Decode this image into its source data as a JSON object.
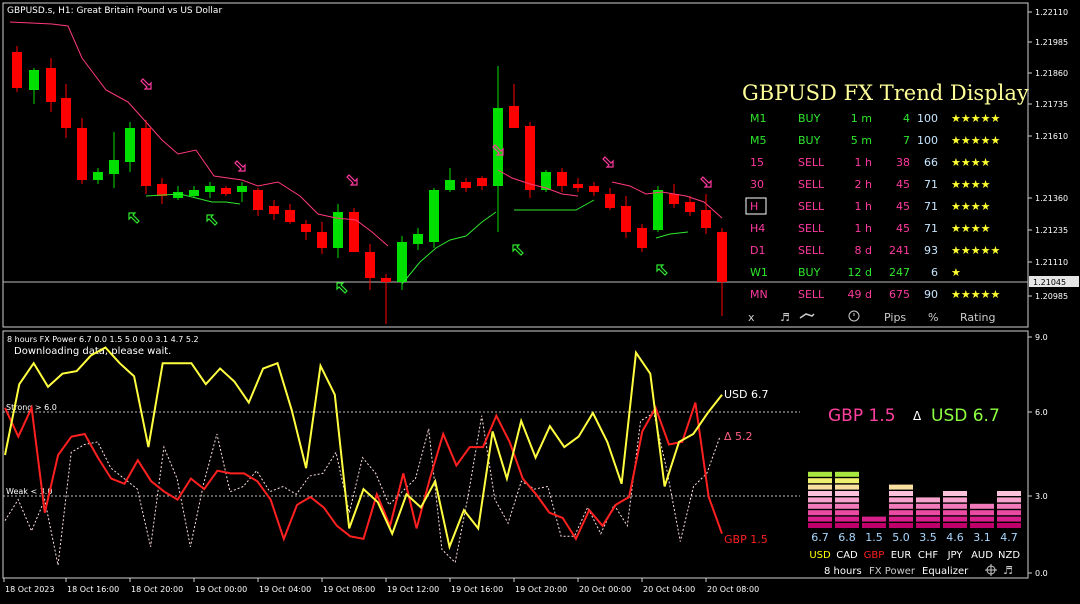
{
  "main_panel": {
    "title": "GBPUSD.s, H1:  Great Britain Pound vs US Dollar",
    "price_labels": [
      "1.22110",
      "1.21985",
      "1.21860",
      "1.21735",
      "1.21610",
      "1.21360",
      "1.21235",
      "1.21110",
      "1.20985"
    ],
    "current_price": "1.21045",
    "current_price_value": 1.21045
  },
  "trend_display": {
    "title": "GBPUSD FX Trend Display",
    "rows": [
      {
        "tf": "M1",
        "signal": "BUY",
        "age": "1 m",
        "pips": "4",
        "pct": "100",
        "stars": "★★★★★",
        "color": "#2ee82e"
      },
      {
        "tf": "M5",
        "signal": "BUY",
        "age": "5 m",
        "pips": "7",
        "pct": "100",
        "stars": "★★★★★",
        "color": "#2ee82e"
      },
      {
        "tf": "15",
        "signal": "SELL",
        "age": "1 h",
        "pips": "38",
        "pct": "66",
        "stars": "★★★★",
        "color": "#ff3aa0"
      },
      {
        "tf": "30",
        "signal": "SELL",
        "age": "2 h",
        "pips": "45",
        "pct": "71",
        "stars": "★★★★",
        "color": "#ff3aa0"
      },
      {
        "tf": "H",
        "signal": "SELL",
        "age": "1 h",
        "pips": "45",
        "pct": "71",
        "stars": "★★★★",
        "color": "#ff3aa0",
        "selected": true
      },
      {
        "tf": "H4",
        "signal": "SELL",
        "age": "1 h",
        "pips": "45",
        "pct": "71",
        "stars": "★★★★",
        "color": "#ff3aa0"
      },
      {
        "tf": "D1",
        "signal": "SELL",
        "age": "8 d",
        "pips": "241",
        "pct": "93",
        "stars": "★★★★★",
        "color": "#ff3aa0"
      },
      {
        "tf": "W1",
        "signal": "BUY",
        "age": "12 d",
        "pips": "247",
        "pct": "6",
        "stars": "★",
        "color": "#2ee82e"
      },
      {
        "tf": "MN",
        "signal": "SELL",
        "age": "49 d",
        "pips": "675",
        "pct": "90",
        "stars": "★★★★★",
        "color": "#ff3aa0"
      }
    ],
    "footer": {
      "close": "x",
      "music": "♬",
      "pips": "Pips",
      "pct": "%",
      "rating": "Rating"
    }
  },
  "power_panel": {
    "title": "8 hours FX Power 6.7 0.0 1.5 5.0 0.0 3.1 4.7 5.2",
    "downloading": "Downloading data,  please wait.",
    "strong_label": "Strong > 6.0",
    "weak_label": "Weak < 3.0",
    "axis_labels": [
      "9.0",
      "6.0",
      "3.0",
      "0.0"
    ],
    "usd_label": "USD 6.7",
    "delta_label": "Δ 5.2",
    "gbp_label": "GBP 1.5",
    "big_gbp": "GBP 1.5",
    "big_delta": "Δ",
    "big_usd": "USD 6.7",
    "lines_data": {
      "usd": [
        4.5,
        7.2,
        8.0,
        7.1,
        7.6,
        7.7,
        8.3,
        8.6,
        8.0,
        7.5,
        4.8,
        8.0,
        8.0,
        8.0,
        7.2,
        7.8,
        7.3,
        6.5,
        7.8,
        8.0,
        6.2,
        4.0,
        7.9,
        6.8,
        1.7,
        3.2,
        2.7,
        1.5,
        3.0,
        2.5,
        3.5,
        1.0,
        2.4,
        1.7,
        5.4,
        3.6,
        5.8,
        4.4,
        5.6,
        4.8,
        5.2,
        6.1,
        5.0,
        3.4,
        8.4,
        7.6,
        3.3,
        5.0,
        5.3,
        6.1,
        6.8
      ],
      "gbp": [
        6.3,
        5.2,
        6.3,
        2.3,
        4.5,
        5.2,
        5.3,
        4.4,
        3.6,
        3.4,
        4.3,
        3.5,
        3.1,
        2.8,
        3.6,
        3.2,
        3.9,
        3.8,
        3.8,
        3.5,
        2.8,
        1.3,
        2.6,
        2.9,
        2.5,
        1.8,
        1.4,
        1.3,
        3.0,
        1.8,
        3.8,
        1.7,
        3.6,
        5.3,
        4.1,
        4.8,
        4.8,
        6.0,
        5.0,
        3.6,
        3.0,
        2.3,
        2.1,
        1.3,
        2.4,
        1.8,
        2.6,
        2.9,
        5.4,
        6.3,
        4.9,
        5.0,
        6.5,
        2.9,
        1.5
      ],
      "delta": [
        2.0,
        2.8,
        1.6,
        2.8,
        0.3,
        4.6,
        4.9,
        5.0,
        4.0,
        3.6,
        3.2,
        1.0,
        4.8,
        3.6,
        1.0,
        3.4,
        5.3,
        3.1,
        3.3,
        3.9,
        3.1,
        3.3,
        3.0,
        3.7,
        3.8,
        4.6,
        2.3,
        4.4,
        3.8,
        2.6,
        3.1,
        3.6,
        5.5,
        0.9,
        0.4,
        3.0,
        6.0,
        2.8,
        1.9,
        3.5,
        3.2,
        3.3,
        1.4,
        1.4,
        2.5,
        1.5,
        2.6,
        1.8,
        5.8,
        6.1,
        3.9,
        1.2,
        3.3,
        3.8,
        5.2
      ]
    },
    "equalizer": {
      "currencies": [
        "USD",
        "CAD",
        "GBP",
        "EUR",
        "CHF",
        "JPY",
        "AUD",
        "NZD"
      ],
      "values": [
        "6.7",
        "6.8",
        "1.5",
        "5.0",
        "3.5",
        "4.6",
        "3.1",
        "4.7"
      ],
      "label_colors": [
        "#ffff00",
        "#ffffff",
        "#ff2020",
        "#ffffff",
        "#ffffff",
        "#ffffff",
        "#ffffff",
        "#ffffff"
      ],
      "footer": {
        "hours": "8 hours",
        "power": "FX Power",
        "eq": "Equalizer"
      }
    }
  },
  "time_axis": [
    "18 Oct 2023",
    "18 Oct 16:00",
    "18 Oct 20:00",
    "19 Oct 00:00",
    "19 Oct 04:00",
    "19 Oct 08:00",
    "19 Oct 12:00",
    "19 Oct 16:00",
    "19 Oct 20:00",
    "20 Oct 00:00",
    "20 Oct 04:00",
    "20 Oct 08:00"
  ],
  "colors": {
    "bull": "#00e000",
    "bear": "#ff0000",
    "usd": "#ffff40",
    "gbp": "#ff2020",
    "delta": "#ff6080",
    "buy": "#2ee82e",
    "sell": "#ff3aa0",
    "info": "#ffff99"
  }
}
